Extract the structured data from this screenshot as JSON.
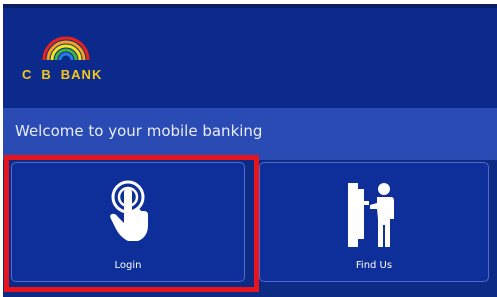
{
  "app": {
    "logo_letters": [
      "C",
      "B",
      "BANK"
    ],
    "welcome": "Welcome to your mobile banking"
  },
  "tiles": [
    {
      "label": "Login",
      "icon": "touch-hand-icon"
    },
    {
      "label": "Find Us",
      "icon": "atm-person-icon"
    }
  ],
  "colors": {
    "background": "#0d2a85",
    "band": "#2b4bb4",
    "logo_text": "#f4c81a",
    "highlight": "#e8141b"
  }
}
